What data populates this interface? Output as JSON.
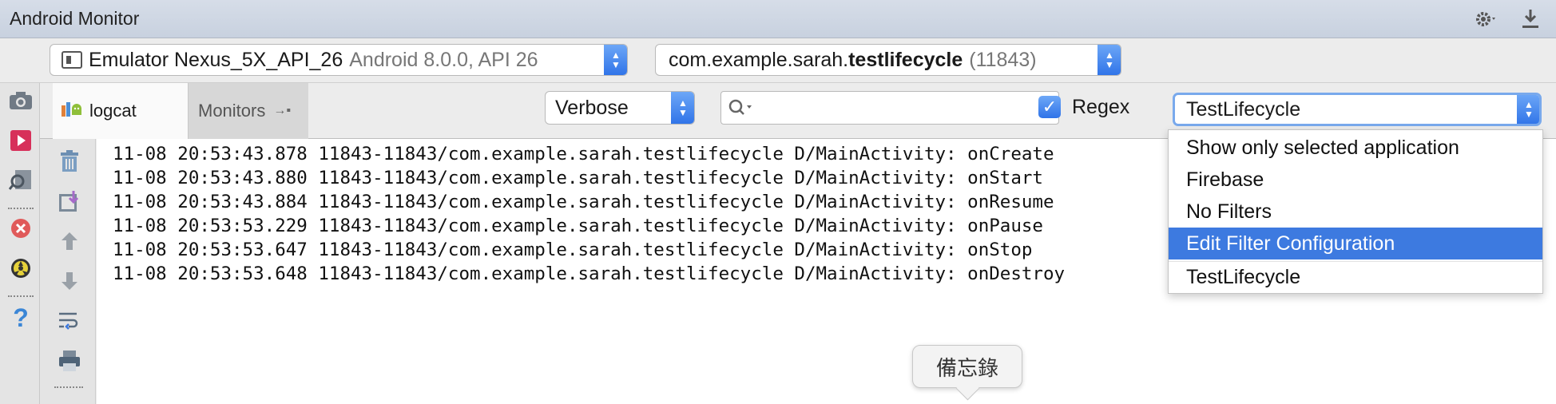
{
  "window": {
    "title": "Android Monitor"
  },
  "device_selector": {
    "name": "Emulator Nexus_5X_API_26",
    "detail": "Android 8.0.0, API 26"
  },
  "process_selector": {
    "prefix": "com.example.sarah.",
    "bold": "testlifecycle",
    "pid": "(11843)"
  },
  "tabs": {
    "logcat": "logcat",
    "monitors": "Monitors"
  },
  "log_level": {
    "selected": "Verbose"
  },
  "search": {
    "value": ""
  },
  "regex": {
    "label": "Regex",
    "checked": true
  },
  "filter_selector": {
    "selected": "TestLifecycle"
  },
  "filter_options": [
    {
      "label": "Show only selected application",
      "selected": false
    },
    {
      "label": "Firebase",
      "selected": false
    },
    {
      "label": "No Filters",
      "selected": false
    },
    {
      "label": "Edit Filter Configuration",
      "selected": true
    },
    {
      "label": "TestLifecycle",
      "selected": false
    }
  ],
  "log_lines": [
    "11-08 20:53:43.878 11843-11843/com.example.sarah.testlifecycle D/MainActivity: onCreate",
    "11-08 20:53:43.880 11843-11843/com.example.sarah.testlifecycle D/MainActivity: onStart",
    "11-08 20:53:43.884 11843-11843/com.example.sarah.testlifecycle D/MainActivity: onResume",
    "11-08 20:53:53.229 11843-11843/com.example.sarah.testlifecycle D/MainActivity: onPause",
    "11-08 20:53:53.647 11843-11843/com.example.sarah.testlifecycle D/MainActivity: onStop",
    "11-08 20:53:53.648 11843-11843/com.example.sarah.testlifecycle D/MainActivity: onDestroy"
  ],
  "tooltip": {
    "text": "備忘錄"
  },
  "icons": {
    "settings": "gear-icon",
    "hide": "hide-panel-icon",
    "screenshot": "camera-icon",
    "record": "record-icon",
    "layout": "layout-inspector-icon",
    "terminate": "terminate-icon",
    "gc": "gc-icon",
    "help": "help-icon",
    "clear": "trash-icon",
    "export": "export-icon",
    "up": "arrow-up-icon",
    "down": "arrow-down-icon",
    "wrap": "soft-wrap-icon",
    "print": "print-icon"
  }
}
